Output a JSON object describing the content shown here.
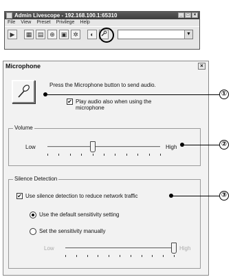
{
  "app": {
    "title": "Admin Livescope - 192.168.100.1:65310",
    "menu": [
      "File",
      "View",
      "Preset",
      "Privilege",
      "Help"
    ],
    "window_buttons": [
      "_",
      "□",
      "×"
    ],
    "address_value": ""
  },
  "dialog": {
    "title": "Microphone",
    "close_label": "×",
    "prompt": "Press the Microphone button to send audio.",
    "play_audio_label_line1": "Play audio also when using the",
    "play_audio_label_line2": "microphone",
    "play_audio_checked": true,
    "volume": {
      "legend": "Volume",
      "low_label": "Low",
      "high_label": "High",
      "level": 0.4
    },
    "silence": {
      "legend": "Silence Detection",
      "enable_label": "Use silence detection to reduce network traffic",
      "enable_checked": true,
      "default_label": "Use the default sensitivity setting",
      "manual_label": "Set the sensitivity manually",
      "selected": "default",
      "low_label": "Low",
      "high_label": "High",
      "level": 1.0
    }
  },
  "callouts": [
    "①",
    "②",
    "③"
  ]
}
